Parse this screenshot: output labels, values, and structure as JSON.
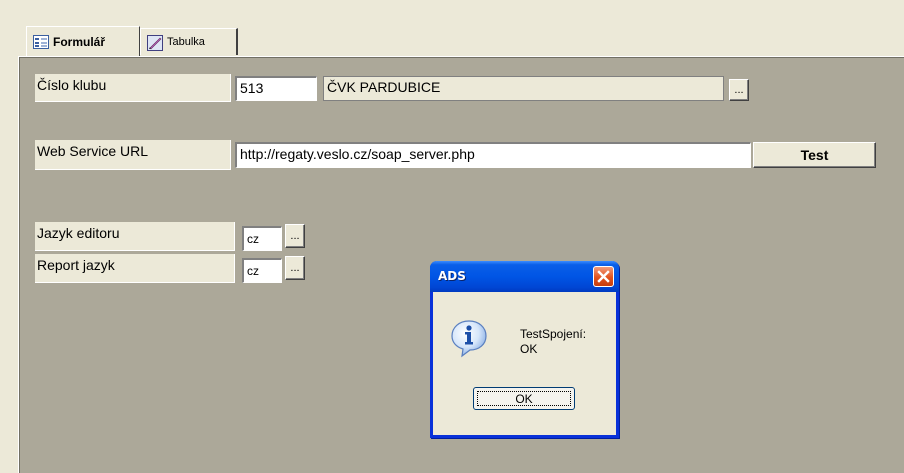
{
  "tabs": [
    {
      "label": "Formulář",
      "active": true,
      "icon": "form-icon"
    },
    {
      "label": "Tabulka",
      "active": false,
      "icon": "table-icon"
    }
  ],
  "form": {
    "club_number": {
      "label": "Číslo klubu",
      "value": "513",
      "name": "ČVK PARDUBICE",
      "browse": "..."
    },
    "web_service_url": {
      "label": "Web Service URL",
      "value": "http://regaty.veslo.cz/soap_server.php",
      "test_button": "Test"
    },
    "editor_language": {
      "label": "Jazyk editoru",
      "value": "cz",
      "browse": "..."
    },
    "report_language": {
      "label": "Report jazyk",
      "value": "cz",
      "browse": "..."
    }
  },
  "dialog": {
    "title": "ADS",
    "icon": "information-icon",
    "message_line1": "TestSpojení:",
    "message_line2": "OK",
    "ok_label": "OK"
  },
  "colors": {
    "panel": "#aca899",
    "window": "#ece9d8",
    "titlebar": "#0055e5",
    "close": "#e2531f"
  }
}
